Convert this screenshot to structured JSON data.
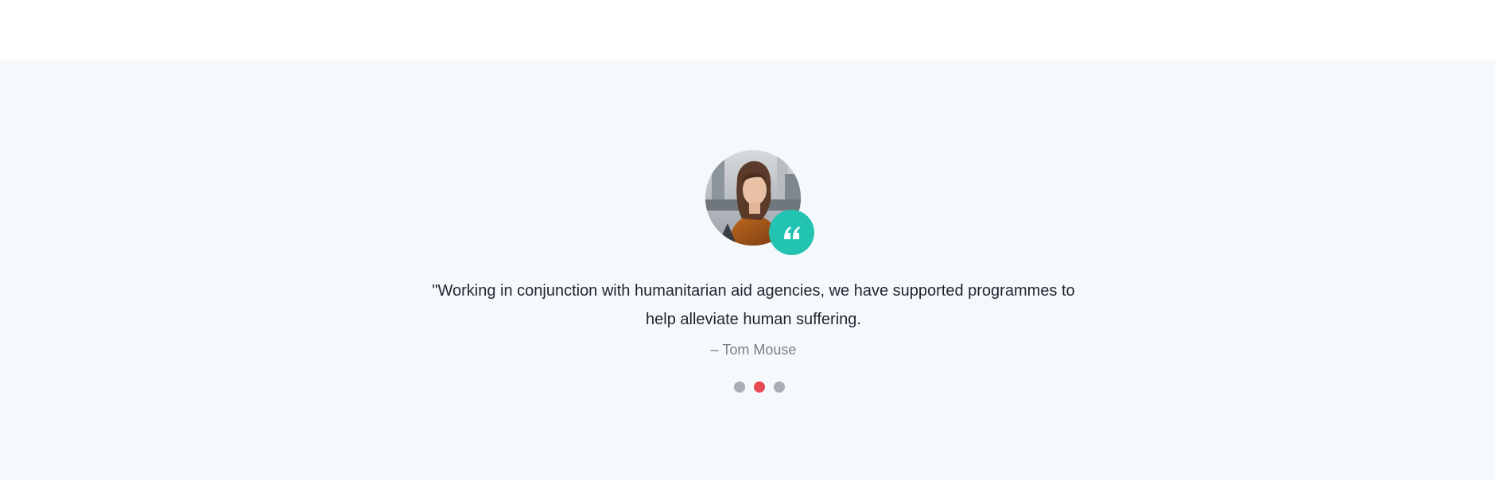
{
  "colors": {
    "section_background": "#f5f9fb",
    "accent": "#22c3b0",
    "active_dot": "#e84a54",
    "inactive_dot": "#a9adb3",
    "quote_text": "#1f2430",
    "author_text": "#7b8089"
  },
  "testimonial": {
    "avatar_alt": "woman-portrait",
    "badge_icon": "quote-icon",
    "quote": "\"Working in conjunction with humanitarian aid agencies, we have supported programmes to help alleviate human suffering.",
    "author": "– Tom Mouse"
  },
  "carousel": {
    "active_index": 1,
    "dots": [
      "slide-1",
      "slide-2",
      "slide-3"
    ]
  }
}
